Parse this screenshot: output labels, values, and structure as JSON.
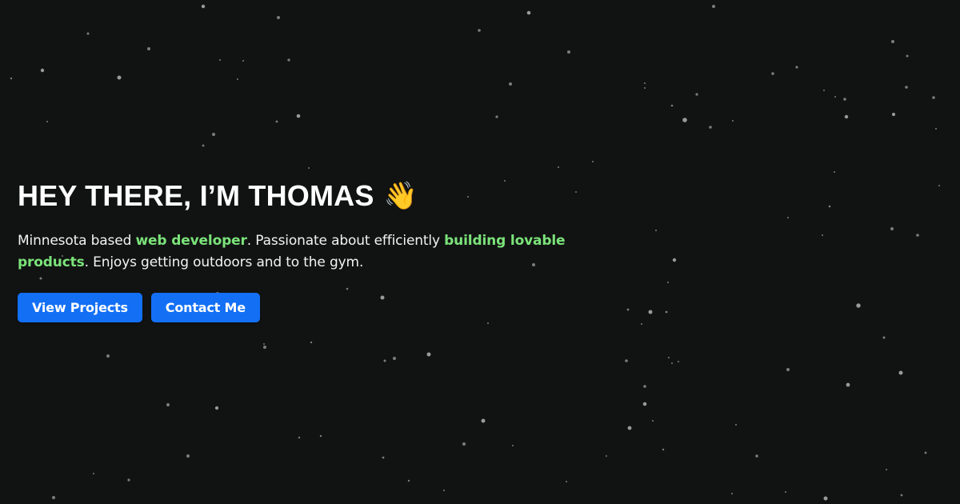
{
  "hero": {
    "title": "HEY THERE, I’M THOMAS",
    "title_emoji": "👋",
    "title_emoji_name": "waving-hand-icon",
    "intro_part_1": "Minnesota based ",
    "highlight_1": "web developer",
    "intro_part_2": ". Passionate about efficiently ",
    "highlight_2": "building lovable products",
    "intro_part_3": ". Enjoys getting outdoors and to the gym."
  },
  "buttons": {
    "view_projects": "View Projects",
    "contact_me": "Contact Me"
  },
  "colors": {
    "background": "#111312",
    "heading": "#ffffff",
    "body_text": "#f2f2f2",
    "highlight": "#7be37a",
    "button_primary": "#1370f5",
    "star": "#a8aaa9"
  }
}
